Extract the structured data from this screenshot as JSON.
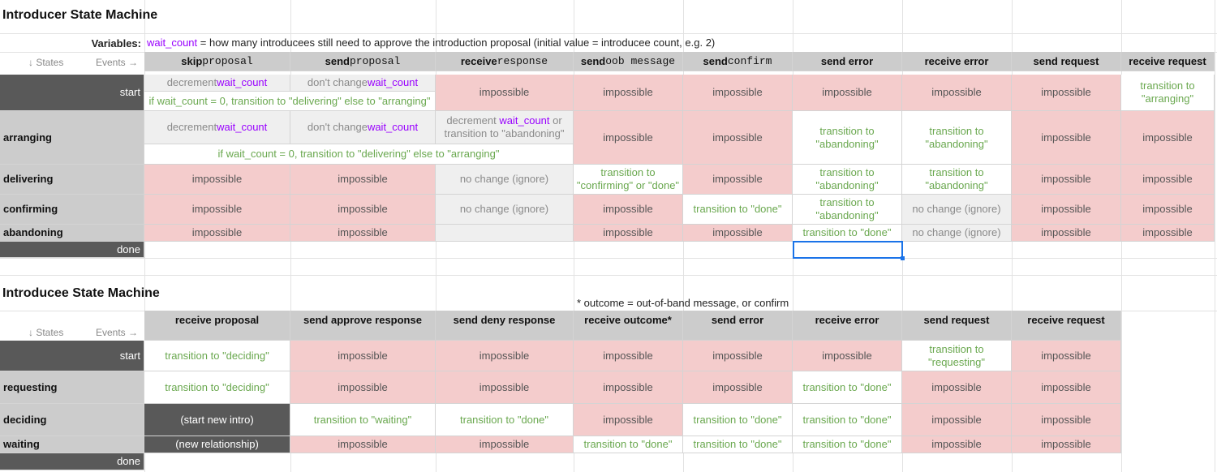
{
  "introducer": {
    "title": "Introducer State Machine",
    "variables_label": "Variables:",
    "var_name": "wait_count",
    "var_desc": " = how many introducees still need to approve the introduction proposal (initial value = introducee count, e.g. 2)",
    "states_label": "↓ States",
    "events_label": "Events →",
    "headers": [
      {
        "bold": "skip",
        "mono": " proposal"
      },
      {
        "bold": "send",
        "mono": " proposal"
      },
      {
        "bold": "receive",
        "mono": " response"
      },
      {
        "bold": "send",
        "mono": " oob message"
      },
      {
        "bold": "send",
        "mono": " confirm"
      },
      {
        "bold": "send error",
        "mono": ""
      },
      {
        "bold": "receive error",
        "mono": ""
      },
      {
        "bold": "send request",
        "mono": ""
      },
      {
        "bold": "receive request",
        "mono": ""
      }
    ],
    "states": [
      "start",
      "arranging",
      "delivering",
      "confirming",
      "abandoning",
      "done"
    ],
    "txt": {
      "impossible": "impossible",
      "decrement": "decrement ",
      "dont_change": "don't change ",
      "if_wait": "if wait_count = 0, transition to \"delivering\" else to \"arranging\"",
      "to_arranging": "transition to \"arranging\"",
      "decrement_or": " or",
      "to_abandoning_line": "transition to \"abandoning\"",
      "to_abandoning": "transition to \"abandoning\"",
      "no_change": "no change (ignore)",
      "to_conf_done": "transition to \"confirming\" or \"done\"",
      "to_done": "transition to \"done\""
    }
  },
  "introducee": {
    "title": "Introducee State Machine",
    "note": "* outcome = out-of-band message, or confirm",
    "states_label": "↓ States",
    "events_label": "Events →",
    "headers": [
      "receive proposal",
      "send approve response",
      "send deny response",
      "receive outcome*",
      "send error",
      "receive error",
      "send request",
      "receive request"
    ],
    "states": [
      "start",
      "requesting",
      "deciding",
      "waiting",
      "done"
    ],
    "txt": {
      "impossible": "impossible",
      "to_deciding": "transition to \"deciding\"",
      "to_requesting": "transition to \"requesting\"",
      "to_done": "transition to \"done\"",
      "to_waiting": "transition to \"waiting\"",
      "start_new_intro": "(start new intro)",
      "new_relationship": "(new relationship)"
    }
  }
}
